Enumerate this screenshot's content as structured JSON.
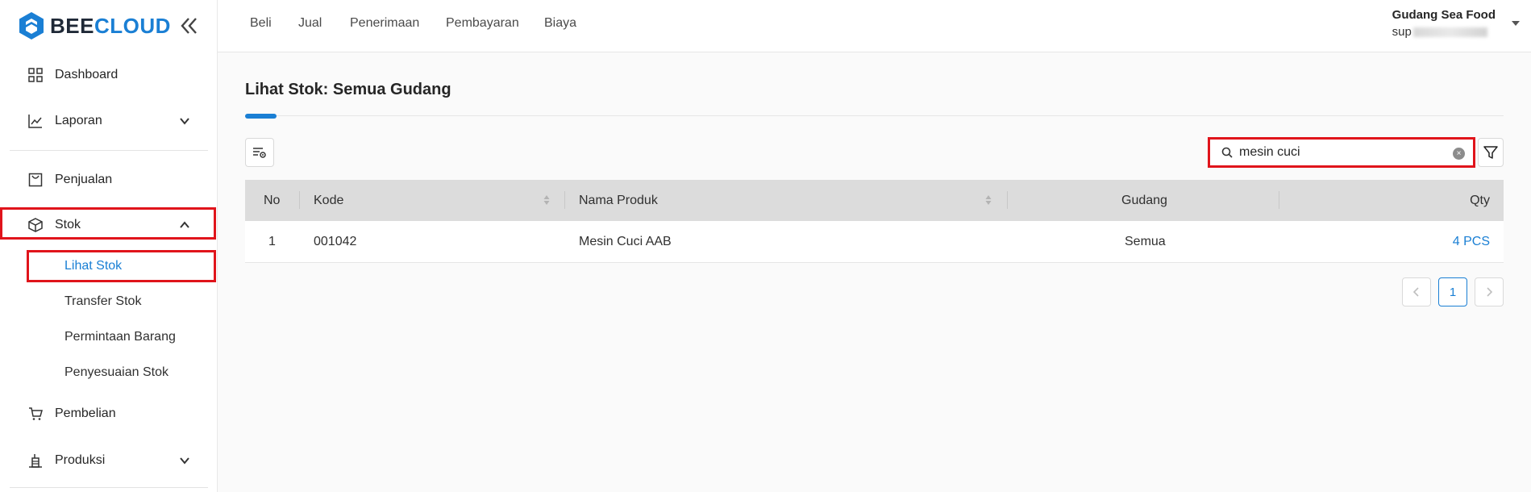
{
  "brand": {
    "part1": "BEE",
    "part2": "CLOUD",
    "color": "#1a7fd4"
  },
  "sidebar": {
    "items": [
      {
        "label": "Dashboard",
        "icon": "dashboard-icon"
      },
      {
        "label": "Laporan",
        "icon": "chart-line-icon",
        "expandable": true
      },
      {
        "label": "Penjualan",
        "icon": "shopping-bag-icon"
      },
      {
        "label": "Stok",
        "icon": "box-icon",
        "expandable": true,
        "expanded": true
      },
      {
        "label": "Pembelian",
        "icon": "cart-icon"
      },
      {
        "label": "Produksi",
        "icon": "factory-icon",
        "expandable": true
      }
    ],
    "stok_sub": [
      {
        "label": "Lihat Stok",
        "active": true
      },
      {
        "label": "Transfer Stok"
      },
      {
        "label": "Permintaan Barang"
      },
      {
        "label": "Penyesuaian Stok"
      }
    ]
  },
  "topnav": {
    "links": [
      "Beli",
      "Jual",
      "Penerimaan",
      "Pembayaran",
      "Biaya"
    ],
    "user_name": "Gudang Sea Food",
    "user_email_prefix": "sup"
  },
  "page": {
    "title": "Lihat Stok: Semua Gudang"
  },
  "search": {
    "value": "mesin cuci"
  },
  "table": {
    "columns": [
      "No",
      "Kode",
      "Nama Produk",
      "Gudang",
      "Qty"
    ],
    "rows": [
      {
        "no": "1",
        "kode": "001042",
        "nama": "Mesin Cuci AAB",
        "gudang": "Semua",
        "qty": "4 PCS"
      }
    ]
  },
  "pagination": {
    "current": "1"
  },
  "colors": {
    "accent": "#1a7fd4",
    "highlight": "#e0141b",
    "header_bg": "#dcdcdc"
  }
}
